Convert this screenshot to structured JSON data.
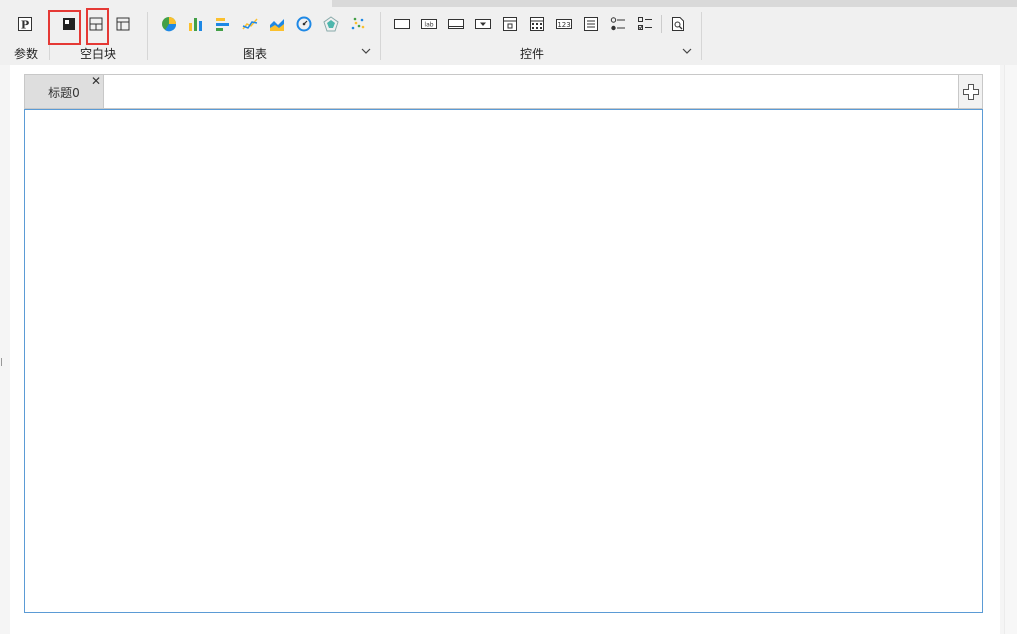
{
  "toolbar": {
    "param_group": {
      "label": "参数",
      "icons": [
        "param-p-icon"
      ]
    },
    "blank_group": {
      "label": "空白块",
      "icons": [
        "absolute-layout-icon",
        "split-layout-icon",
        "table-layout-icon"
      ]
    },
    "chart_group": {
      "label": "图表",
      "icons": [
        "pie-chart-icon",
        "column-chart-icon",
        "bar-chart-icon",
        "line-chart-icon",
        "area-chart-icon",
        "gauge-chart-icon",
        "radar-chart-icon",
        "scatter-chart-icon"
      ]
    },
    "widget_group": {
      "label": "控件",
      "icons": [
        "text-box-icon",
        "label-widget-icon",
        "button-widget-icon",
        "dropdown-widget-icon",
        "date-widget-icon",
        "calendar-widget-icon",
        "number-widget-icon",
        "list-widget-icon",
        "radio-group-icon",
        "checkbox-group-icon",
        "query-button-icon"
      ]
    },
    "label_widget_text": "lab",
    "number_widget_text": "123"
  },
  "tabs": [
    {
      "label": "标题0",
      "close": "✕"
    }
  ],
  "colors": {
    "highlight": "#e53935",
    "panel_border": "#5b9bd5",
    "chart_blue": "#1e88e5",
    "chart_yellow": "#fbc02d",
    "chart_green": "#43a047"
  }
}
